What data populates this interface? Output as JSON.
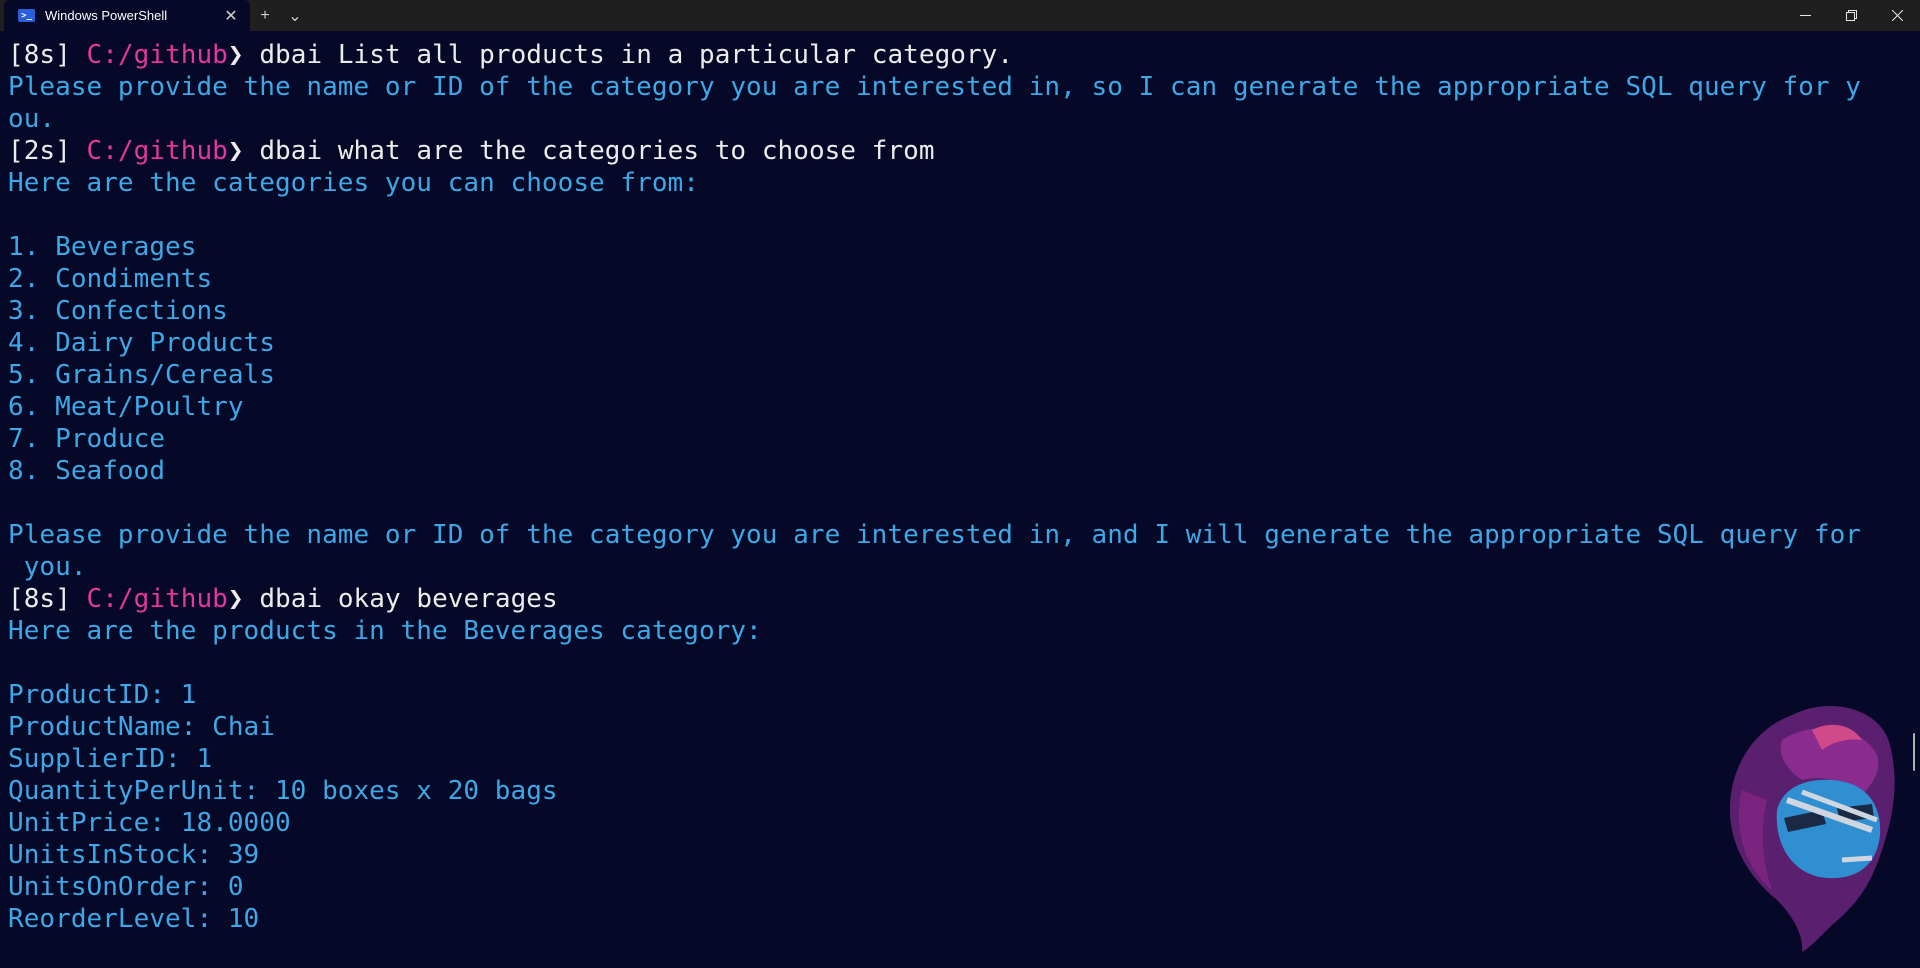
{
  "window": {
    "tab_title": "Windows PowerShell",
    "tab_icon": "powershell-icon",
    "new_tab_label": "+",
    "dropdown_label": "⌄",
    "close_tab_label": "✕"
  },
  "colors": {
    "background": "#050826",
    "output": "#3da8e8",
    "prompt_path": "#e5369e",
    "command": "#ececec"
  },
  "terminal": {
    "lines": [
      {
        "time": "[8s]",
        "path": "C:/github",
        "cmd": "dbai List all products in a particular category."
      },
      {
        "text": "Please provide the name or ID of the category you are interested in, so I can generate the appropriate SQL query for y"
      },
      {
        "text": "ou."
      },
      {
        "time": "[2s]",
        "path": "C:/github",
        "cmd": "dbai what are the categories to choose from"
      },
      {
        "text": "Here are the categories you can choose from:"
      },
      {
        "text": ""
      },
      {
        "text": "1. Beverages"
      },
      {
        "text": "2. Condiments"
      },
      {
        "text": "3. Confections"
      },
      {
        "text": "4. Dairy Products"
      },
      {
        "text": "5. Grains/Cereals"
      },
      {
        "text": "6. Meat/Poultry"
      },
      {
        "text": "7. Produce"
      },
      {
        "text": "8. Seafood"
      },
      {
        "text": ""
      },
      {
        "text": "Please provide the name or ID of the category you are interested in, and I will generate the appropriate SQL query for"
      },
      {
        "text": " you."
      },
      {
        "time": "[8s]",
        "path": "C:/github",
        "cmd": "dbai okay beverages"
      },
      {
        "text": "Here are the products in the Beverages category:"
      },
      {
        "text": ""
      },
      {
        "text": "ProductID: 1"
      },
      {
        "text": "ProductName: Chai"
      },
      {
        "text": "SupplierID: 1"
      },
      {
        "text": "QuantityPerUnit: 10 boxes x 20 bags"
      },
      {
        "text": "UnitPrice: 18.0000"
      },
      {
        "text": "UnitsInStock: 39"
      },
      {
        "text": "UnitsOnOrder: 0"
      },
      {
        "text": "ReorderLevel: 10"
      }
    ],
    "prompt_glyph": "❯"
  }
}
